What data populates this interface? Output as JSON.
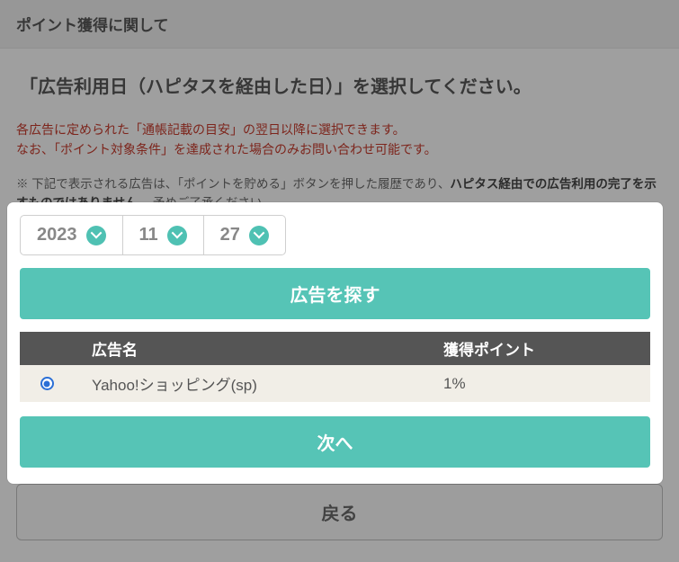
{
  "header": {
    "title": "ポイント獲得に関して"
  },
  "heading": "「広告利用日（ハピタスを経由した日）」を選択してください。",
  "red_note_line1": "各広告に定められた「通帳記載の目安」の翌日以降に選択できます。",
  "red_note_line2": "なお、「ポイント対象条件」を達成された場合のみお問い合わせ可能です。",
  "gray_note_prefix": "※ 下記で表示される広告は、「ポイントを貯める」ボタンを押した履歴であり、",
  "gray_note_bold": "ハピタス経由での広告利用の完了を示すものではありません。",
  "gray_note_suffix": "予めご了承ください。",
  "date": {
    "year": "2023",
    "month": "11",
    "day": "27"
  },
  "buttons": {
    "search": "広告を探す",
    "next": "次へ",
    "back": "戻る"
  },
  "table": {
    "head": {
      "name": "広告名",
      "points": "獲得ポイント"
    },
    "rows": [
      {
        "name": "Yahoo!ショッピング(sp)",
        "points": "1%",
        "selected": true
      }
    ]
  }
}
